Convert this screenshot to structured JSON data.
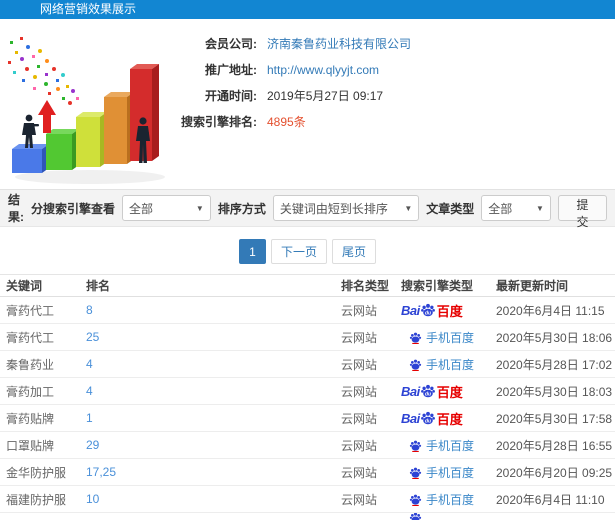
{
  "header": {
    "title": "网络营销效果展示"
  },
  "info": {
    "company_label": "会员公司:",
    "company_value": "济南秦鲁药业科技有限公司",
    "url_label": "推广地址:",
    "url_value": "http://www.qlyyjt.com",
    "open_label": "开通时间:",
    "open_value": "2019年5月27日 09:17",
    "rank_label": "搜索引擎排名:",
    "rank_value": "4895条"
  },
  "filters": {
    "result_label": "结果:",
    "engine_label": "分搜索引擎查看",
    "engine_value": "全部",
    "sort_label": "排序方式",
    "sort_value": "关键词由短到长排序",
    "article_label": "文章类型",
    "article_value": "全部",
    "submit_label": "提交"
  },
  "pagination": {
    "current": "1",
    "next": "下一页",
    "last": "尾页"
  },
  "table": {
    "headers": [
      "关键词",
      "排名",
      "排名类型",
      "搜索引擎类型",
      "最新更新时间"
    ],
    "engine_labels": {
      "baidu_bai": "Bai",
      "baidu_cn": "百度",
      "mobile_text": "手机百度"
    },
    "rows": [
      {
        "keyword": "膏药代工",
        "rank": "8",
        "rank_type": "云网站",
        "engine": "baidu",
        "time": "2020年6月4日 11:15"
      },
      {
        "keyword": "膏药代工",
        "rank": "25",
        "rank_type": "云网站",
        "engine": "mobile-baidu",
        "time": "2020年5月30日 18:06"
      },
      {
        "keyword": "秦鲁药业",
        "rank": "4",
        "rank_type": "云网站",
        "engine": "mobile-baidu",
        "time": "2020年5月28日 17:02"
      },
      {
        "keyword": "膏药加工",
        "rank": "4",
        "rank_type": "云网站",
        "engine": "baidu",
        "time": "2020年5月30日 18:03"
      },
      {
        "keyword": "膏药贴牌",
        "rank": "1",
        "rank_type": "云网站",
        "engine": "baidu",
        "time": "2020年5月30日 17:58"
      },
      {
        "keyword": "口罩贴牌",
        "rank": "29",
        "rank_type": "云网站",
        "engine": "mobile-baidu",
        "time": "2020年5月28日 16:55"
      },
      {
        "keyword": "金华防护服",
        "rank": "17,25",
        "rank_type": "云网站",
        "engine": "mobile-baidu",
        "time": "2020年6月20日 09:25"
      },
      {
        "keyword": "福建防护服",
        "rank": "10",
        "rank_type": "云网站",
        "engine": "mobile-baidu",
        "time": "2020年6月4日 11:10"
      }
    ],
    "partial_row": {
      "engine": "mobile-baidu"
    }
  },
  "colors": {
    "topbar_blue": "#1286d2",
    "link_blue": "#337ab7",
    "highlight_red": "#e4502f",
    "baidu_blue": "#2d43d4",
    "baidu_red": "#e60000",
    "active_page": "#337ab7"
  }
}
